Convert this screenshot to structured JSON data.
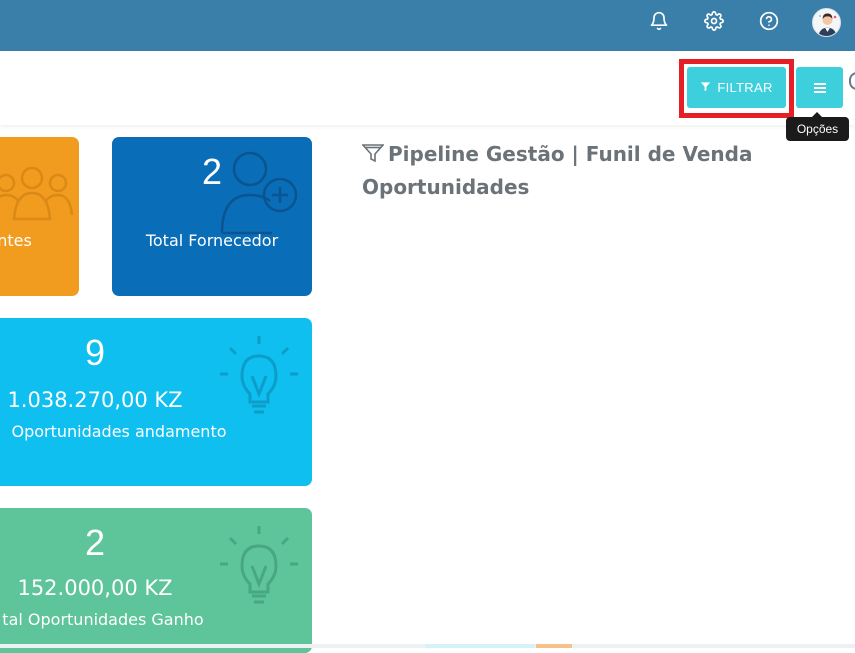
{
  "topbar": {
    "bg_color": "#3a7fa9",
    "icons": [
      "bell-icon",
      "gear-icon",
      "help-icon"
    ],
    "avatar": "user-avatar"
  },
  "toolbar": {
    "filter_label": "FILTRAR",
    "filter_icon": "filter-icon",
    "menu_icon": "hamburger-icon",
    "menu_tooltip": "Opções",
    "accent_color": "#3ecfdc",
    "highlight_color": "#e41f26"
  },
  "cards": {
    "clients": {
      "label": "ntes",
      "color": "#f29c1f",
      "icon": "users-icon"
    },
    "suppliers": {
      "value": "2",
      "label": "Total Fornecedor",
      "color": "#0a6db8",
      "icon": "user-add-icon"
    },
    "opportunities_progress": {
      "value": "9",
      "amount": "1.038.270,00 KZ",
      "label": "Oportunidades andamento",
      "color": "#0fbff0",
      "icon": "lightbulb-icon"
    },
    "opportunities_won": {
      "value": "2",
      "amount": "152.000,00 KZ",
      "label": "tal Oportunidades Ganho",
      "color": "#5ec49a",
      "icon": "lightbulb-icon"
    }
  },
  "pipeline": {
    "title": "Pipeline Gestão | Funil de Venda Oportunidades",
    "icon": "funnel-icon"
  }
}
